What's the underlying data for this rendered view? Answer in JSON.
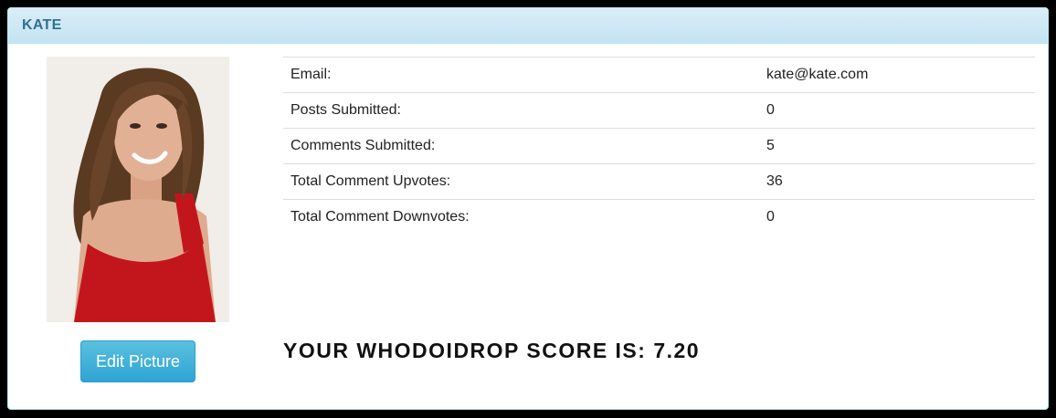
{
  "panel": {
    "title": "KATE"
  },
  "profile": {
    "avatar_icon": "profile-photo",
    "edit_button_label": "Edit Picture"
  },
  "stats": [
    {
      "label": "Email:",
      "value": "kate@kate.com"
    },
    {
      "label": "Posts Submitted:",
      "value": "0"
    },
    {
      "label": "Comments Submitted:",
      "value": "5"
    },
    {
      "label": "Total Comment Upvotes:",
      "value": "36"
    },
    {
      "label": "Total Comment Downvotes:",
      "value": "0"
    }
  ],
  "score_text": "YOUR WHODOIDROP SCORE IS: 7.20",
  "colors": {
    "heading_bg": "#d9edf7",
    "heading_text": "#31708f",
    "button_bg": "#5bc0de",
    "page_bg": "#000000"
  }
}
